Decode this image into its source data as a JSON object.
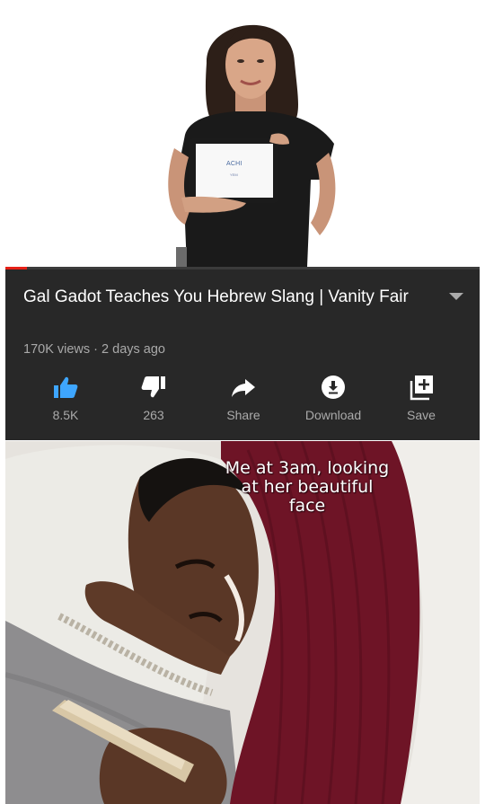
{
  "video": {
    "tablet_line_1": "ACHI",
    "tablet_line_2": "YEM",
    "progress_fraction": 0.045
  },
  "info": {
    "title": "Gal Gadot Teaches You Hebrew Slang | Vanity Fair",
    "meta": "170K views · 2 days ago"
  },
  "actions": {
    "like": {
      "label": "8.5K",
      "icon": "thumbs-up-icon",
      "color": "#3ea6ff"
    },
    "dislike": {
      "label": "263",
      "icon": "thumbs-down-icon"
    },
    "share": {
      "label": "Share",
      "icon": "share-arrow-icon"
    },
    "download": {
      "label": "Download",
      "icon": "download-icon"
    },
    "save": {
      "label": "Save",
      "icon": "add-to-playlist-icon"
    }
  },
  "meme": {
    "caption_line_1": "Me at 3am, looking",
    "caption_line_2": "at her beautiful",
    "caption_line_3": "face"
  },
  "colors": {
    "panel_bg": "#282828",
    "progress": "#e62117",
    "like_active": "#3ea6ff",
    "icon_default": "#ffffff",
    "secondary_text": "#aaaaaa"
  }
}
